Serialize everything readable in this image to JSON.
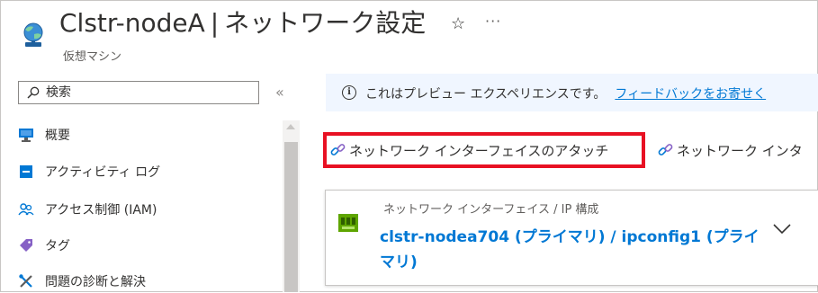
{
  "header": {
    "title": "Clstr-nodeA",
    "separator": "|",
    "page_name": "ネットワーク設定",
    "subtitle": "仮想マシン",
    "favorite_glyph": "☆",
    "more_glyph": "···"
  },
  "sidebar": {
    "search_placeholder": "検索",
    "collapse_glyph": "«",
    "items": [
      {
        "label": "概要",
        "icon": "monitor-icon"
      },
      {
        "label": "アクティビティ ログ",
        "icon": "activity-log-icon"
      },
      {
        "label": "アクセス制御 (IAM)",
        "icon": "iam-people-icon"
      },
      {
        "label": "タグ",
        "icon": "tag-icon"
      },
      {
        "label": "問題の診断と解決",
        "icon": "wrench-icon"
      }
    ]
  },
  "info_banner": {
    "text": "これはプレビュー エクスペリエンスです。",
    "link": "フィードバックをお寄せく"
  },
  "commands": {
    "attach": "ネットワーク インターフェイスのアタッチ",
    "detach": "ネットワーク インタ"
  },
  "card": {
    "label": "ネットワーク インターフェイス / IP 構成",
    "link": "clstr-nodea704 (プライマリ) / ipconfig1 (プライマリ)"
  },
  "colors": {
    "accent": "#0078d4",
    "highlight": "#e81123",
    "banner_bg": "#f0f6ff"
  }
}
